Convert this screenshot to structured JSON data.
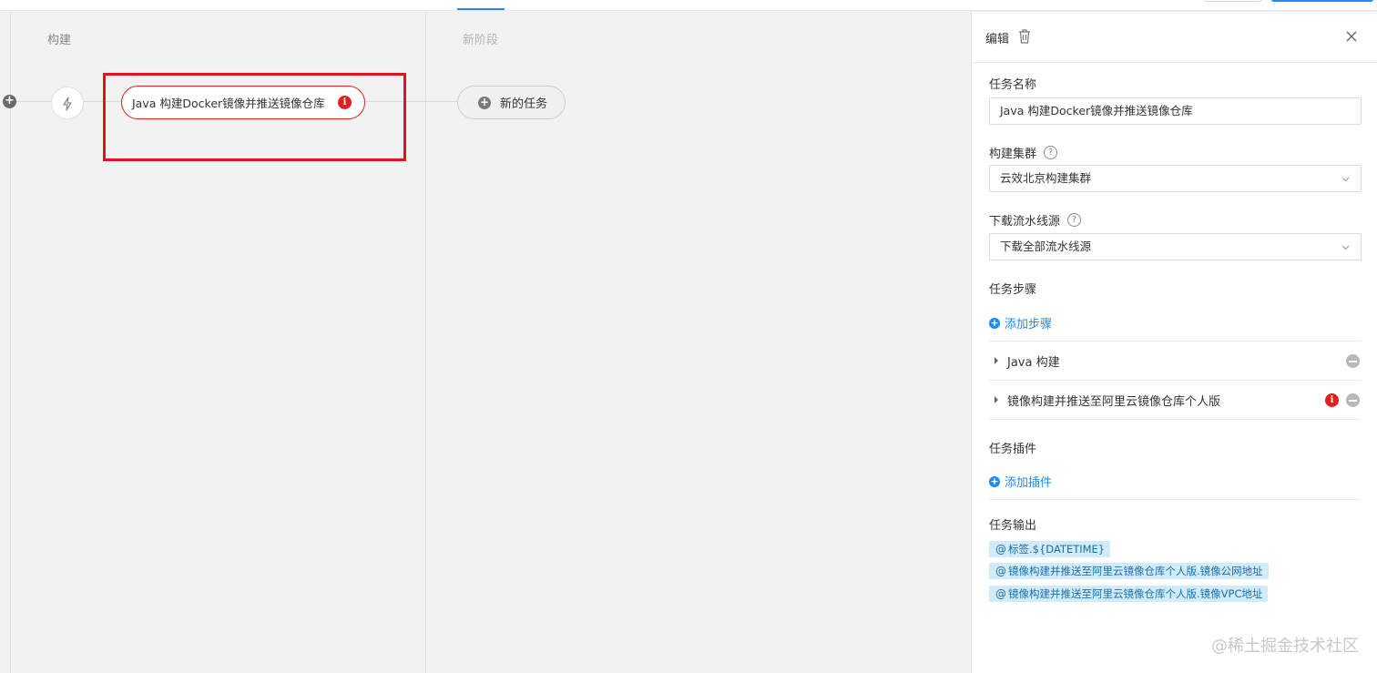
{
  "canvas": {
    "stages": [
      {
        "title": "构建"
      },
      {
        "title": "新阶段"
      }
    ],
    "trigger_icon": "lightning-icon",
    "task_label": "Java 构建Docker镜像并推送镜像仓库",
    "task_error_icon": "i",
    "new_task_label": "新的任务",
    "plus_symbol": "+"
  },
  "panel": {
    "title": "编辑",
    "fields": {
      "task_name_label": "任务名称",
      "task_name_value": "Java 构建Docker镜像并推送镜像仓库",
      "cluster_label": "构建集群",
      "cluster_value": "云效北京构建集群",
      "source_label": "下载流水线源",
      "source_value": "下载全部流水线源",
      "help_symbol": "?"
    },
    "steps_label": "任务步骤",
    "add_step_label": "添加步骤",
    "steps": [
      {
        "label": "Java 构建",
        "has_error": false
      },
      {
        "label": "镜像构建并推送至阿里云镜像仓库个人版",
        "has_error": true
      }
    ],
    "plugins_label": "任务插件",
    "add_plugin_label": "添加插件",
    "outputs_label": "任务输出",
    "outputs": [
      "标签.${DATETIME}",
      "镜像构建并推送至阿里云镜像仓库个人版.镜像公网地址",
      "镜像构建并推送至阿里云镜像仓库个人版.镜像VPC地址"
    ],
    "at_symbol": "@"
  },
  "watermark": "@稀土掘金技术社区",
  "colors": {
    "accent": "#1b8cff",
    "error": "#e02020",
    "highlight_border": "#e0141c",
    "tag_bg": "#d2ebfb"
  }
}
